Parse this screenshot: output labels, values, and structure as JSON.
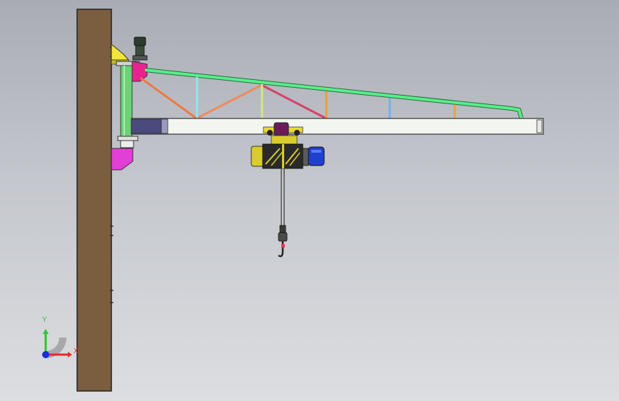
{
  "viewport": {
    "background_top": "#a9acb4",
    "background_bottom": "#dcdee1"
  },
  "model": {
    "wall_color": "#7b5d3f",
    "mast_color": "#6fd07a",
    "tie_rod_color": "#57ee8c",
    "boom_color": "#f3f5f1",
    "bracket_top_color": "#f2e63b",
    "bracket_pink_color": "#e8238f",
    "hoist_body_color": "#2a2a2a",
    "hoist_cap_color": "#d8cc2e",
    "motor_color": "#1f3fcf"
  },
  "triad": {
    "x_label": "X",
    "y_label": "Y",
    "x_color": "#e52a2a",
    "y_color": "#2ec42e",
    "z_color": "#1a2fd8"
  }
}
